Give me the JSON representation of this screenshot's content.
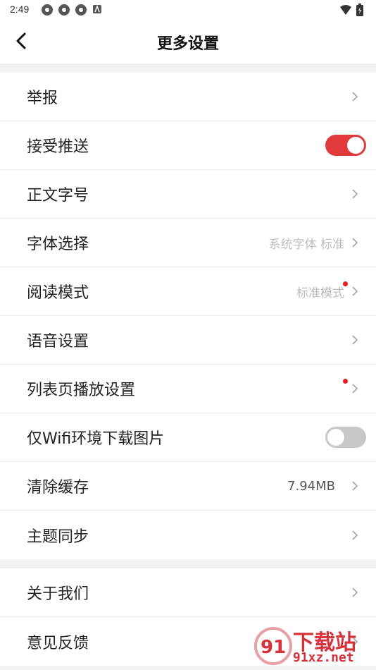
{
  "status_bar": {
    "time": "2:49",
    "left_icons": [
      "app-icon",
      "app-icon",
      "app-icon",
      "a-notification-icon"
    ],
    "right_icons": [
      "wifi-icon",
      "battery-icon"
    ]
  },
  "nav": {
    "title": "更多设置",
    "back_icon": "chevron-left-icon"
  },
  "settings_group_1": {
    "rows": [
      {
        "label": "举报",
        "type": "link"
      },
      {
        "label": "接受推送",
        "type": "toggle",
        "on": true
      },
      {
        "label": "正文字号",
        "type": "link"
      },
      {
        "label": "字体选择",
        "type": "link",
        "value": "系统字体 标准"
      },
      {
        "label": "阅读模式",
        "type": "link",
        "value": "标准模式",
        "badge": true
      },
      {
        "label": "语音设置",
        "type": "link"
      },
      {
        "label": "列表页播放设置",
        "type": "link",
        "badge": true
      },
      {
        "label": "仅Wifi环境下载图片",
        "type": "toggle",
        "on": false
      },
      {
        "label": "清除缓存",
        "type": "link",
        "value": "7.94MB"
      },
      {
        "label": "主题同步",
        "type": "link"
      }
    ]
  },
  "settings_group_2": {
    "rows": [
      {
        "label": "关于我们",
        "type": "link"
      },
      {
        "label": "意见反馈",
        "type": "link"
      }
    ]
  },
  "watermark": {
    "line1": "下载站",
    "line2": "91xz.net",
    "logo_text": "91"
  },
  "colors": {
    "accent": "#e23a3a",
    "badge": "#e02020",
    "toggle_off": "#c8c8c8",
    "value_text": "#bdbdbd"
  }
}
